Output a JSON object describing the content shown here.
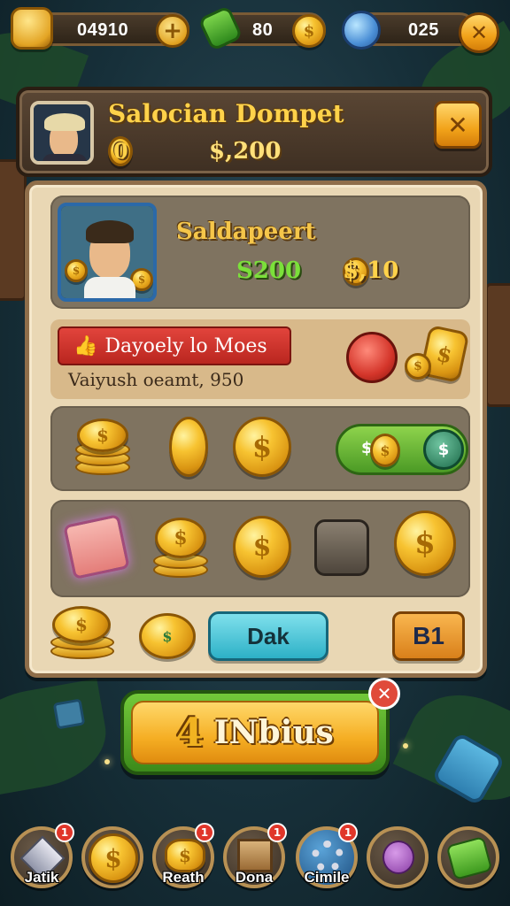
{
  "topbar": {
    "coins_value": "04910",
    "cash_value": "80",
    "gems_value": "025"
  },
  "header": {
    "title": "Salocian Dompet",
    "coin_count": "0",
    "dollar_amount": "$,200"
  },
  "profile": {
    "name": "Saldapeert",
    "green_value": "S200",
    "gold_value": "$,10"
  },
  "offer": {
    "banner": "Dayoely lo Moes",
    "subtext": "Vaiyush oeamt, 950"
  },
  "buttons": {
    "dak": "Dak",
    "b1": "B1",
    "cta_number": "4",
    "cta_label": "INbius"
  },
  "nav": [
    {
      "label": "Jatik",
      "icon": "crystal-icon",
      "badge": "1"
    },
    {
      "label": "",
      "icon": "coin-icon",
      "badge": ""
    },
    {
      "label": "Reath",
      "icon": "coin-stack-icon",
      "badge": "1"
    },
    {
      "label": "Dona",
      "icon": "crate-icon",
      "badge": "1"
    },
    {
      "label": "Cimile",
      "icon": "gear-icon",
      "badge": "1"
    },
    {
      "label": "",
      "icon": "pet-icon",
      "badge": ""
    },
    {
      "label": "",
      "icon": "arrow-icon",
      "badge": ""
    }
  ],
  "colors": {
    "gold": "#f7c331",
    "panel_parchment": "#e9d7b4",
    "header_brown": "#4e3b2b",
    "cta_orange": "#f5ae23",
    "accent_teal": "#2db1c7",
    "alert_red": "#e0362a"
  }
}
